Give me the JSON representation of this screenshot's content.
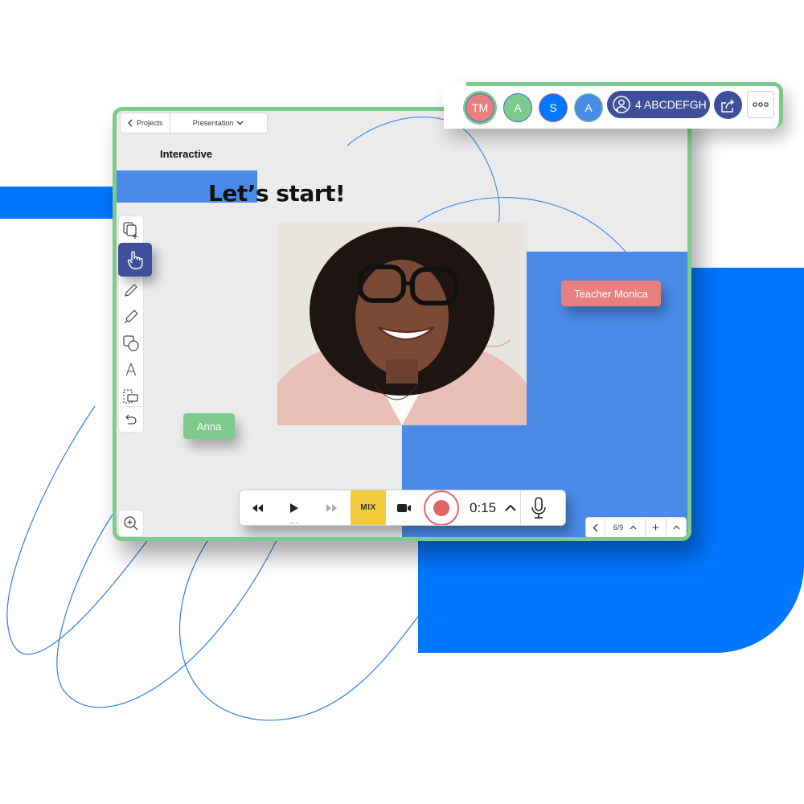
{
  "colors": {
    "brand_blue": "#0077ff",
    "slide_blue": "#4a8be8",
    "frame_green": "#7dcb8c",
    "teacher_red": "#e87f7f",
    "navy": "#3f4f9a",
    "mix_yellow": "#f2cc3c",
    "record_red": "#e06565"
  },
  "nav": {
    "back_icon": "chevron-left-icon",
    "projects_label": "Projects",
    "presentation_label": "Presentation",
    "presentation_icon": "chevron-down-icon"
  },
  "slide": {
    "section_label": "Interactive",
    "title": "Let’s start!",
    "photo_alt": "Smiling woman with glasses and curly hair"
  },
  "participants_tags": {
    "teacher": "Teacher Monica",
    "student": "Anna"
  },
  "toolbar": {
    "tools": [
      {
        "name": "add-slide",
        "icon": "copy-plus-icon"
      },
      {
        "name": "hand",
        "icon": "hand-pointer-icon",
        "active": true
      },
      {
        "name": "pen",
        "icon": "pencil-icon"
      },
      {
        "name": "highlighter",
        "icon": "highlighter-icon"
      },
      {
        "name": "shapes",
        "icon": "shapes-icon"
      },
      {
        "name": "text",
        "icon": "text-icon",
        "glyph": "A"
      },
      {
        "name": "select",
        "icon": "selection-icon"
      }
    ],
    "undo_icon": "undo-icon",
    "zoom_icon": "zoom-in-icon"
  },
  "player": {
    "rewind_icon": "rewind-icon",
    "play_icon": "play-icon",
    "more_dots": "...",
    "forward_icon": "fast-forward-icon",
    "mix_label": "MIX",
    "camera_icon": "video-camera-icon",
    "record_icon": "record-icon",
    "time": "0:15",
    "expand_icon": "chevron-up-icon",
    "mic_icon": "microphone-icon"
  },
  "pager": {
    "prev_icon": "chevron-left-icon",
    "page": "6/9",
    "page_menu_icon": "chevron-up-icon",
    "add_label": "+",
    "collapse_icon": "chevron-up-icon"
  },
  "topbar": {
    "avatars": [
      {
        "initials": "TM",
        "color": "#e87f7f",
        "ring": "#3a6fd6"
      },
      {
        "initials": "A",
        "color": "#7dcb8c",
        "ring": "#3a6fd6"
      },
      {
        "initials": "S",
        "color": "#0077ff",
        "ring": "#e06565"
      },
      {
        "initials": "A",
        "color": "#4a8be8",
        "ring": "#7dcb8c"
      }
    ],
    "invite_label": "4 ABCDEFGH",
    "invite_icon": "add-user-icon",
    "share_icon": "share-icon",
    "more_icon": "more-horizontal-icon"
  }
}
